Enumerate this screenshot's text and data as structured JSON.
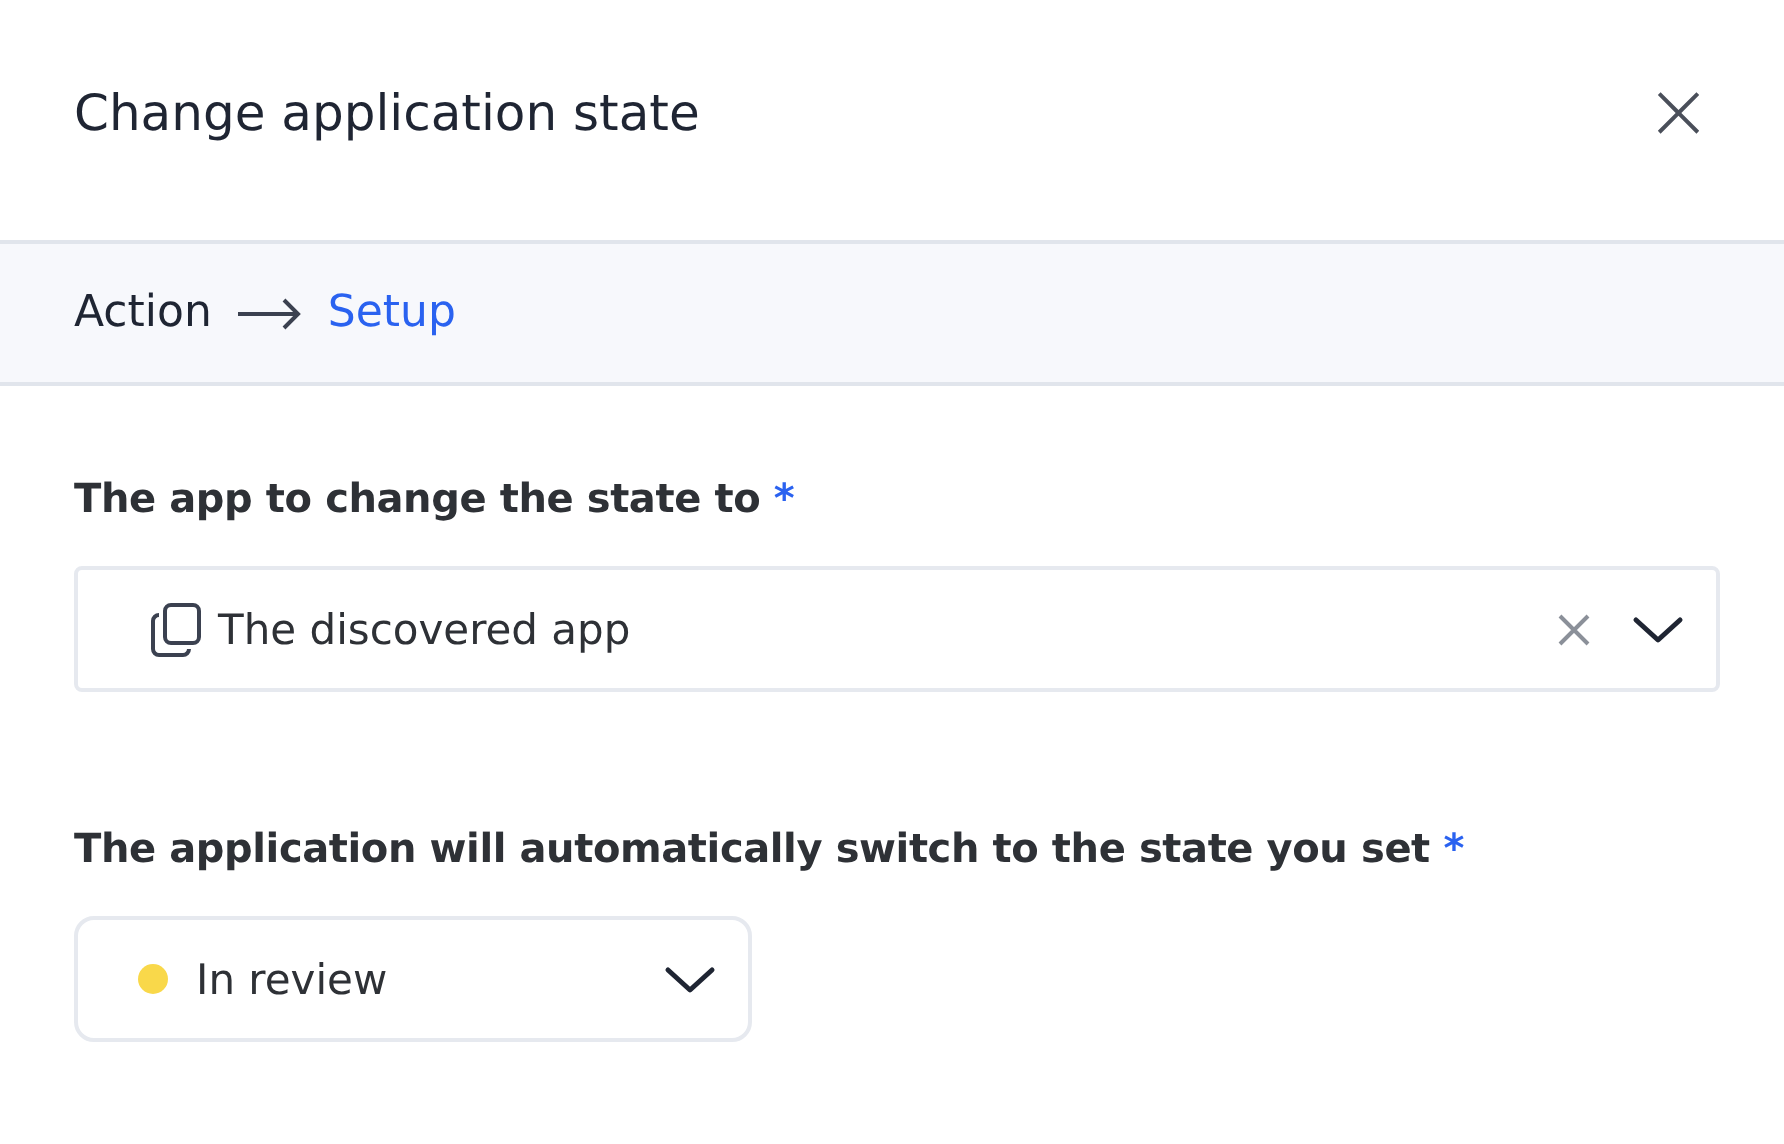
{
  "dialog": {
    "title": "Change application state",
    "close_icon": "×"
  },
  "breadcrumb": [
    {
      "label": "Action",
      "selected": false
    },
    {
      "label": "Setup",
      "selected": true
    }
  ],
  "fields": [
    {
      "kind": "select",
      "label": "The app to change the state to",
      "required_mark": "*",
      "value": "The discovered app",
      "clearable": true
    },
    {
      "kind": "status",
      "label": "The application will automatically switch to the state you set",
      "required_mark": "*",
      "value": "In review",
      "color": "#f9d84a"
    }
  ]
}
